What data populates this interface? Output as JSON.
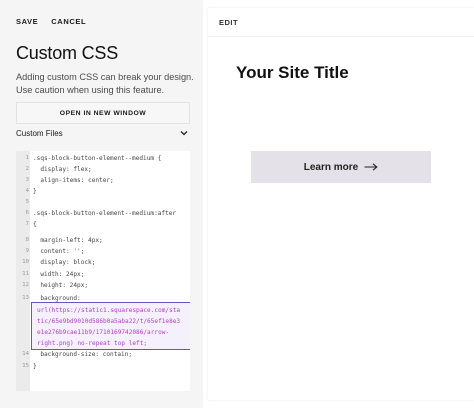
{
  "toolbar": {
    "save_label": "SAVE",
    "cancel_label": "CANCEL"
  },
  "panel": {
    "title": "Custom CSS",
    "warning": "Adding custom CSS can break your design. Use caution when using this feature.",
    "open_window_label": "OPEN IN NEW WINDOW",
    "custom_files_label": "Custom Files"
  },
  "editor": {
    "line_numbers": [
      "1",
      "2",
      "3",
      "4",
      "5",
      "6",
      "7",
      "8",
      "9",
      "10",
      "11",
      "12",
      "13",
      "14",
      "15",
      "16",
      "17"
    ],
    "lines": [
      ".sqs-block-button-element--medium {",
      "  display: flex;",
      "  align-items: center;",
      "}",
      "",
      ".sqs-block-button-element--medium:after",
      "{",
      "  margin-left: 4px;",
      "  content: '';",
      "  display: block;",
      "  width: 24px;",
      "  height: 24px;",
      "  background:"
    ],
    "highlighted_lines": [
      "url(https://static1.squarespace.com/sta",
      "tic/65e9bd9010d586b0a5aba22/t/65ef1e8e3",
      "e1e276b9cae11b9/1710169742086/arrow-",
      "right.png) no-repeat top left;"
    ],
    "after_lines": [
      "  background-size: contain;",
      "}"
    ]
  },
  "preview": {
    "edit_label": "EDIT",
    "site_title": "Your Site Title",
    "button_label": "Learn more",
    "button_icon": "arrow-right-icon"
  },
  "colors": {
    "highlight_border": "#6e4ec9",
    "token_value": "#b03fc2",
    "button_bg": "#e4e2e8"
  }
}
